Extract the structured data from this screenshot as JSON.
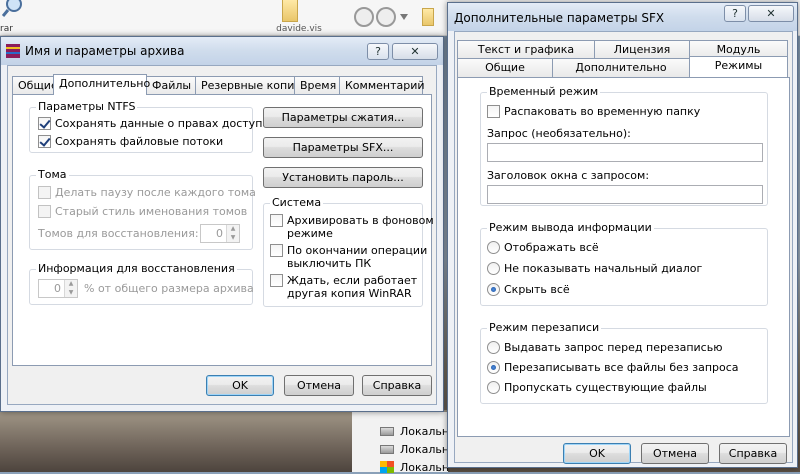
{
  "desktop": {
    "folder_label": "davide.vis",
    "left_label": "rar",
    "drive_label_1": "Локальн",
    "drive_label_2": "Локальн",
    "drive_label_3": "Локальн"
  },
  "archive_dialog": {
    "title": "Имя и параметры архива",
    "help_button": "?",
    "close_button": "✕",
    "tabs": [
      "Общие",
      "Дополнительно",
      "Файлы",
      "Резервные копии",
      "Время",
      "Комментарий"
    ],
    "active_tab": 1,
    "ntfs": {
      "title": "Параметры NTFS",
      "save_access_rights": {
        "label": "Сохранять данные о правах доступа",
        "checked": true
      },
      "save_file_streams": {
        "label": "Сохранять файловые потоки",
        "checked": true
      }
    },
    "volumes": {
      "title": "Тома",
      "pause_after_volume": {
        "label": "Делать паузу после каждого тома",
        "checked": false
      },
      "old_naming": {
        "label": "Старый стиль именования томов",
        "checked": false
      },
      "recovery_volumes_label": "Томов для восстановления:",
      "recovery_volumes_value": "0"
    },
    "recovery_info": {
      "title": "Информация для восстановления",
      "value": "0",
      "suffix": "% от общего размера архива"
    },
    "buttons": {
      "compression": "Параметры сжатия...",
      "sfx": "Параметры SFX...",
      "password": "Установить пароль..."
    },
    "system": {
      "title": "Система",
      "background": {
        "label": "Архивировать в фоновом\nрежиме",
        "line1": "Архивировать в фоновом",
        "line2": "режиме",
        "checked": false
      },
      "shutdown": {
        "line1": "По окончании операции",
        "line2": "выключить ПК",
        "checked": false
      },
      "wait": {
        "line1": "Ждать, если работает",
        "line2": "другая копия WinRAR",
        "checked": false
      }
    },
    "footer": {
      "ok": "OK",
      "cancel": "Отмена",
      "help": "Справка"
    }
  },
  "sfx_dialog": {
    "title": "Дополнительные параметры SFX",
    "help_button": "?",
    "close_button": "✕",
    "tabs_top": [
      "Текст и графика",
      "Лицензия",
      "Модуль"
    ],
    "tabs_bottom": [
      "Общие",
      "Дополнительно",
      "Режимы"
    ],
    "active_tab": "Режимы",
    "temp_mode": {
      "title": "Временный режим",
      "unpack_temp": {
        "label": "Распаковать во временную папку",
        "checked": false
      },
      "prompt_label": "Запрос (необязательно):",
      "prompt_value": "",
      "prompt_title_label": "Заголовок окна с запросом:",
      "prompt_title_value": ""
    },
    "output_mode": {
      "title": "Режим вывода информации",
      "options": [
        "Отображать всё",
        "Не показывать начальный диалог",
        "Скрыть всё"
      ],
      "selected": 2
    },
    "overwrite_mode": {
      "title": "Режим перезаписи",
      "options": [
        "Выдавать запрос перед перезаписью",
        "Перезаписывать все файлы без запроса",
        "Пропускать существующие файлы"
      ],
      "selected": 1
    },
    "footer": {
      "ok": "OK",
      "cancel": "Отмена",
      "help": "Справка"
    }
  }
}
